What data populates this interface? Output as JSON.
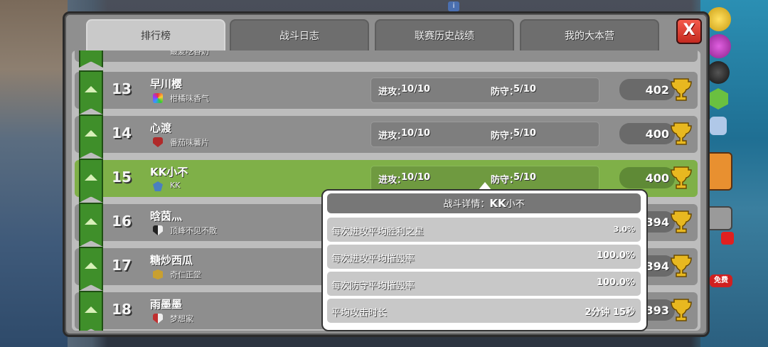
{
  "tabs": [
    {
      "label": "排行榜",
      "active": true
    },
    {
      "label": "战斗日志",
      "active": false
    },
    {
      "label": "联赛历史战绩",
      "active": false
    },
    {
      "label": "我的大本营",
      "active": false
    }
  ],
  "close_label": "X",
  "top_partial": {
    "clan": "最爱吃香奶"
  },
  "rows": [
    {
      "rank": "13",
      "name": "早川樱",
      "clan": "柑橘味香气",
      "attack_label": "进攻：",
      "attack": "10/10",
      "defense_label": "防守：",
      "defense": "5/10",
      "trophies": "402",
      "badge_color": "#3a9b4a",
      "highlight": false
    },
    {
      "rank": "14",
      "name": "心渡",
      "clan": "番茄味薯片",
      "attack_label": "进攻：",
      "attack": "10/10",
      "defense_label": "防守：",
      "defense": "5/10",
      "trophies": "400",
      "badge_color": "#b02a2a",
      "highlight": false
    },
    {
      "rank": "15",
      "name": "KK小不",
      "clan": "KK",
      "attack_label": "进攻：",
      "attack": "10/10",
      "defense_label": "防守：",
      "defense": "5/10",
      "trophies": "400",
      "badge_color": "#4a7fc0",
      "highlight": true
    },
    {
      "rank": "16",
      "name": "晗茵灬",
      "clan": "顶峰不见不散",
      "trophies": "394",
      "badge_color": "#222222",
      "highlight": false
    },
    {
      "rank": "17",
      "name": "糖炒西瓜",
      "clan": "奇仁正堂",
      "trophies": "394",
      "badge_color": "#c9a030",
      "highlight": false
    },
    {
      "rank": "18",
      "name": "雨墨墨",
      "clan": "梦想家",
      "trophies": "393",
      "badge_color": "#c03030",
      "highlight": false
    }
  ],
  "popup": {
    "title_prefix": "战斗详情：",
    "title_name_bold": "KK",
    "title_name_rest": "小不",
    "items": [
      {
        "label": "每次进攻平均胜利之星",
        "value": "3.0%"
      },
      {
        "label": "每次进攻平均摧毁率",
        "value": "100.0%"
      },
      {
        "label": "每次防守平均摧毁率",
        "value": "100.0%"
      },
      {
        "label": "平均攻击时长",
        "value": "2分钟 15秒"
      }
    ]
  },
  "side": {
    "free_label": "免费"
  },
  "colors": {
    "accent_green": "#7fb048",
    "close_red": "#e04030",
    "trophy_gold": "#e8b820"
  }
}
